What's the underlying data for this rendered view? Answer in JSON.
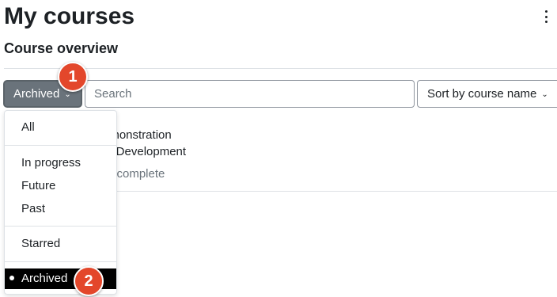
{
  "page": {
    "title": "My courses",
    "section_title": "Course overview"
  },
  "toolbar": {
    "filter_label": "Archived",
    "search_placeholder": "Search",
    "search_value": "",
    "sort_label": "Sort by course name"
  },
  "course": {
    "name": "emonstration",
    "category": "2_Development",
    "progress": "% complete"
  },
  "dropdown": {
    "items": [
      {
        "label": "All"
      },
      {
        "label": "In progress"
      },
      {
        "label": "Future"
      },
      {
        "label": "Past"
      },
      {
        "label": "Starred"
      },
      {
        "label": "Archived",
        "selected": true
      }
    ]
  },
  "annotations": {
    "step1": "1",
    "step2": "2",
    "color": "#e3472b"
  },
  "colors": {
    "filter_button": "#6a737b",
    "selected_item": "#000000"
  }
}
